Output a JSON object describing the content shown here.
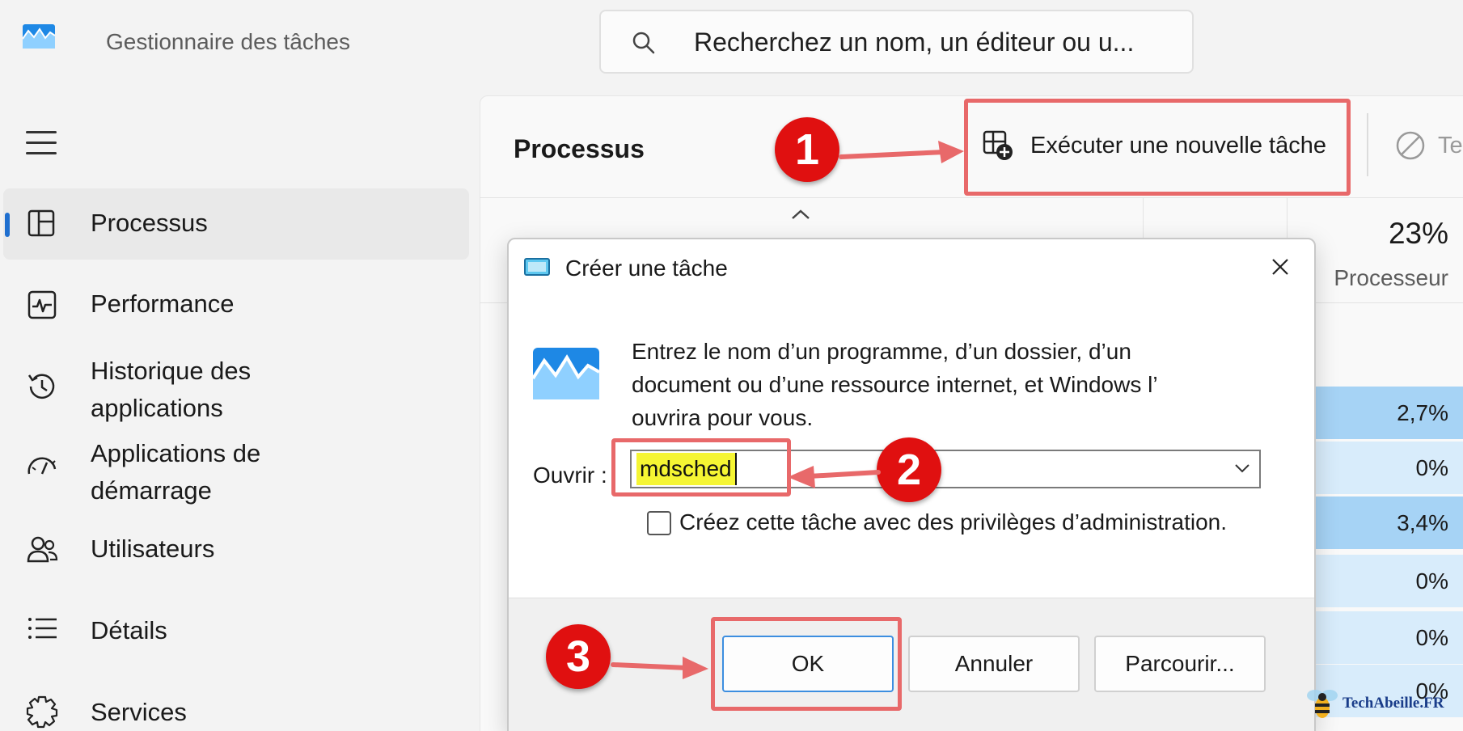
{
  "app": {
    "title": "Gestionnaire des tâches",
    "search_placeholder": "Recherchez un nom, un éditeur ou u..."
  },
  "sidebar": {
    "items": [
      {
        "label": "Processus",
        "icon": "processes-icon",
        "active": true
      },
      {
        "label": "Performance",
        "icon": "performance-icon"
      },
      {
        "label": "Historique des applications",
        "icon": "app-history-icon"
      },
      {
        "label": "Applications de démarrage",
        "icon": "startup-apps-icon"
      },
      {
        "label": "Utilisateurs",
        "icon": "users-icon"
      },
      {
        "label": "Détails",
        "icon": "details-icon"
      },
      {
        "label": "Services",
        "icon": "services-icon"
      }
    ]
  },
  "main": {
    "title": "Processus",
    "run_new_task_label": "Exécuter une nouvelle tâche",
    "end_task_label": "Te",
    "cpu_total": "23%",
    "cpu_column": "Processeur",
    "cpu_rows": [
      {
        "value": "2,7%",
        "highlight": "strong"
      },
      {
        "value": "0%",
        "highlight": "light"
      },
      {
        "value": "3,4%",
        "highlight": "strong"
      },
      {
        "value": "0%",
        "highlight": "light"
      },
      {
        "value": "0%",
        "highlight": "light"
      },
      {
        "value": "0%",
        "highlight": "light"
      }
    ]
  },
  "dialog": {
    "title": "Créer une tâche",
    "description": "Entrez le nom d’un programme, d’un dossier, d’un document ou d’une ressource internet, et Windows l’ ouvrira pour vous.",
    "open_label": "Ouvrir :",
    "open_value": "mdsched",
    "admin_label": "Créez cette tâche avec des privilèges d’administration.",
    "admin_checked": false,
    "buttons": {
      "ok": "OK",
      "cancel": "Annuler",
      "browse": "Parcourir..."
    }
  },
  "annotations": {
    "steps": [
      "1",
      "2",
      "3"
    ],
    "color": "#e01010",
    "highlight_color": "#e8696a"
  },
  "watermark": "TechAbeille.FR",
  "colors": {
    "accent": "#1f6fcf",
    "cpu_strong": "#a6d3f5",
    "cpu_light": "#d8ecfb",
    "text_highlight": "#f5f533"
  }
}
